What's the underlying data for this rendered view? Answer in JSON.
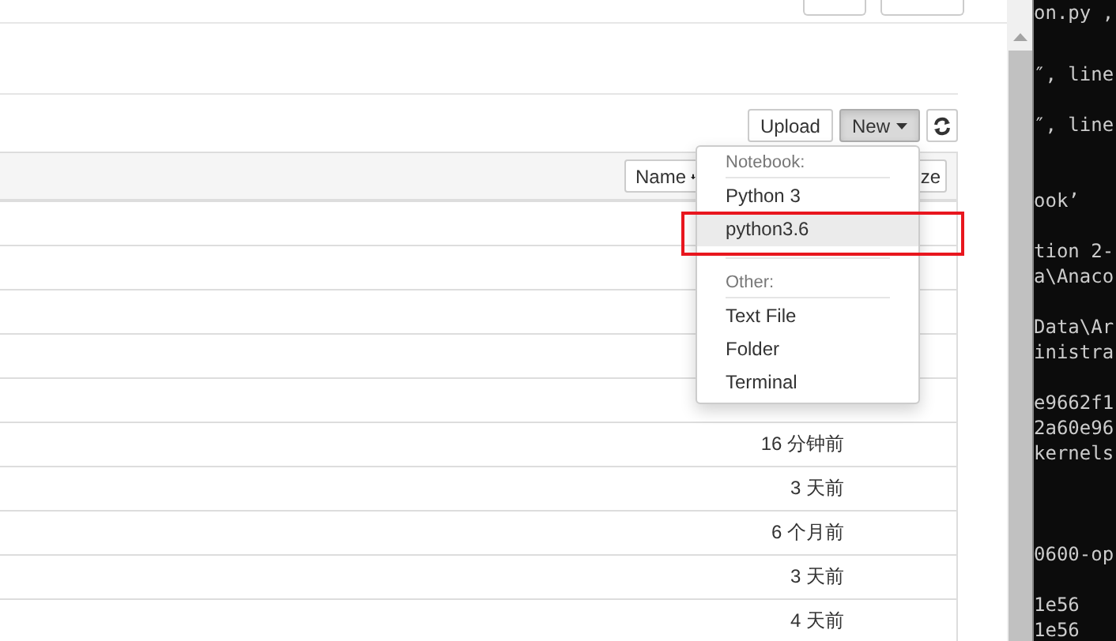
{
  "toolbar": {
    "buttons": [
      {
        "kind": "text",
        "label": "Upload",
        "pressed": false
      },
      {
        "kind": "dropdown",
        "label": "New",
        "pressed": true
      },
      {
        "kind": "refresh",
        "pressed": false
      }
    ]
  },
  "table": {
    "sort_buttons": [
      {
        "label": "Name",
        "sorted": true
      },
      {
        "label": "ze",
        "sorted": false
      }
    ],
    "rows": [
      {},
      {},
      {},
      {},
      {},
      {
        "modified": "16 分钟前"
      },
      {
        "modified": "3 天前"
      },
      {
        "modified": "6 个月前"
      },
      {
        "modified": "3 天前"
      },
      {
        "modified": "4 天前"
      }
    ]
  },
  "new_menu": {
    "open": true,
    "sections": [
      {
        "heading": "Notebook:",
        "items": [
          {
            "label": "Python 3",
            "selected": false
          },
          {
            "label": "python3.6",
            "selected": true
          }
        ]
      },
      {
        "heading": "Other:",
        "items": [
          {
            "label": "Text File",
            "selected": false
          },
          {
            "label": "Folder",
            "selected": false
          },
          {
            "label": "Terminal",
            "selected": false
          }
        ]
      }
    ]
  },
  "terminal": {
    "lines": [
      "on.py ,",
      "″, line",
      "″, line",
      "ook’",
      "tion 2-",
      "a\\Anaco",
      "Data\\Ar",
      "inistra",
      "e9662f1",
      "2a60e96",
      "kernels",
      "0600-op",
      "1e56",
      "1e56"
    ]
  }
}
